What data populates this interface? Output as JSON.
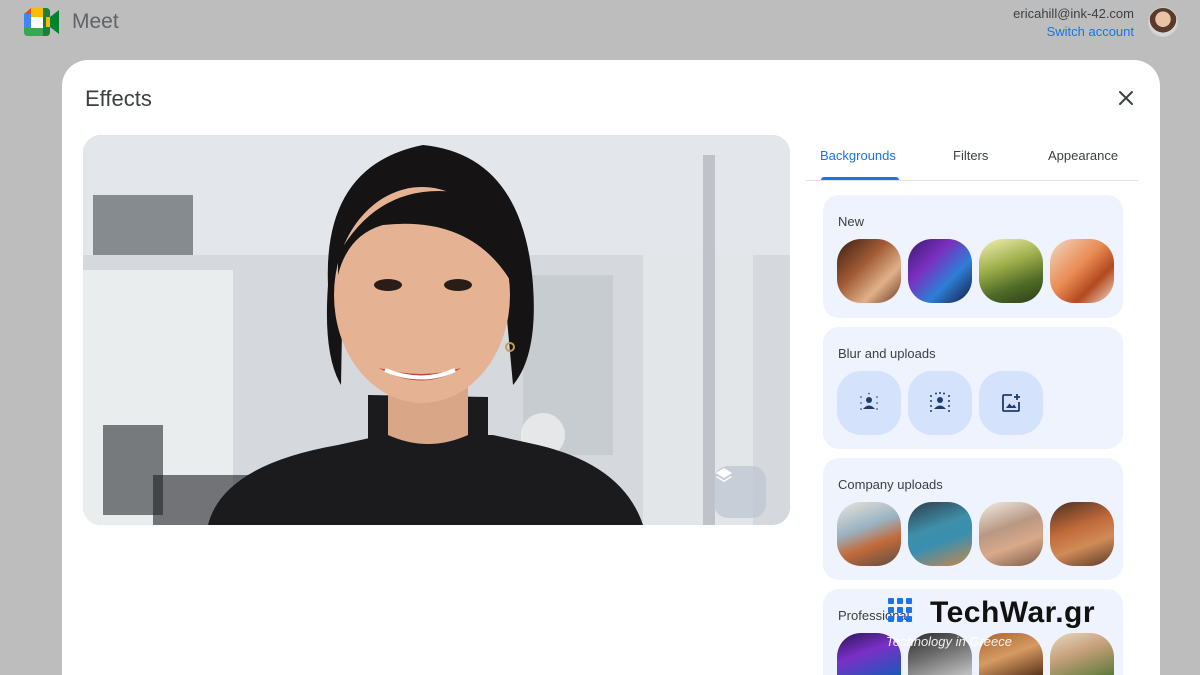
{
  "app": {
    "name": "Meet"
  },
  "account": {
    "email": "ericahill@ink-42.com",
    "switch_label": "Switch account"
  },
  "dialog": {
    "title": "Effects"
  },
  "tabs": [
    {
      "label": "Backgrounds",
      "active": true
    },
    {
      "label": "Filters",
      "active": false
    },
    {
      "label": "Appearance",
      "active": false
    }
  ],
  "sections": {
    "new": {
      "label": "New",
      "thumbs": [
        "rustic-room",
        "neon-arcade",
        "forest-path",
        "orange-living-room"
      ]
    },
    "blur": {
      "label": "Blur and uploads",
      "buttons": [
        "slight-blur-icon",
        "blur-icon",
        "add-photo-icon"
      ]
    },
    "company": {
      "label": "Company uploads",
      "thumbs": [
        "office-lounge",
        "office-kitchen",
        "office-cafe",
        "office-booth"
      ]
    },
    "professional": {
      "label": "Professional",
      "thumbs": [
        "neon-stage",
        "glass-hall",
        "wooden-room",
        "plant-room"
      ]
    }
  },
  "watermark": {
    "brand": "TechWar.gr",
    "tagline": "Technology in Greece"
  },
  "colors": {
    "accent": "#1a73e8",
    "panel_bg": "#eef3fd",
    "button_bg": "#d4e2fb",
    "backdrop": "#bdbdbd"
  }
}
